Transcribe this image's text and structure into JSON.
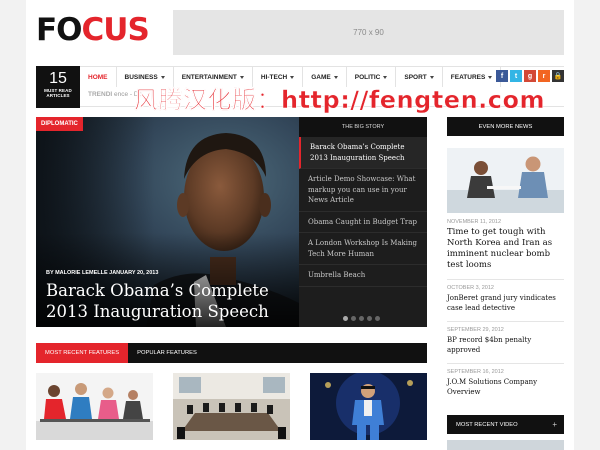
{
  "logo": {
    "part1": "FO",
    "part2": "CUS"
  },
  "ad": {
    "label": "770 x 90"
  },
  "must_read": {
    "count": "15",
    "label": "MUST READ ARTICLES"
  },
  "nav": [
    {
      "label": "Home",
      "dropdown": false,
      "active": true
    },
    {
      "label": "Business",
      "dropdown": true
    },
    {
      "label": "Entertainment",
      "dropdown": true
    },
    {
      "label": "Hi-Tech",
      "dropdown": true
    },
    {
      "label": "Game",
      "dropdown": true
    },
    {
      "label": "Politic",
      "dropdown": true
    },
    {
      "label": "Sport",
      "dropdown": true
    },
    {
      "label": "Features",
      "dropdown": true
    }
  ],
  "social": [
    {
      "icon": "facebook-icon",
      "glyph": "f",
      "color": "#3b5998"
    },
    {
      "icon": "twitter-icon",
      "glyph": "t",
      "color": "#33b5e5"
    },
    {
      "icon": "google-plus-icon",
      "glyph": "g",
      "color": "#d34836"
    },
    {
      "icon": "rss-icon",
      "glyph": "r",
      "color": "#f26522"
    },
    {
      "icon": "lock-icon",
      "glyph": "&#x1F512;",
      "color": "#333333"
    }
  ],
  "trending": {
    "label": "TRENDI",
    "text": "ence - De"
  },
  "watermark": "风腾汉化版：http://fengten.com",
  "hero": {
    "tag": "Diplomatic",
    "byline": "By Malorie Lemelle January 20, 2013",
    "title": "Barack Obama’s Complete 2013 Inauguration Speech"
  },
  "big_story": {
    "heading": "The Big Story",
    "items": [
      "Barack Obama’s Complete 2013 Inauguration Speech",
      "Article Demo Showcase: What markup you can use in your News Article",
      "Obama Caught in Budget Trap",
      "A London Workshop Is Making Tech More Human",
      "Umbrella Beach"
    ],
    "active_index": 0,
    "dots": 5,
    "active_dot": 0
  },
  "features": {
    "tabs": [
      {
        "label": "Most Recent Features",
        "active": true
      },
      {
        "label": "Popular Features",
        "active": false
      }
    ]
  },
  "sidebar": {
    "heading": "Even More News",
    "lead": {
      "date": "November 11, 2012",
      "title": "Time to get tough with North Korea and Iran as imminent nuclear bomb test looms"
    },
    "items": [
      {
        "date": "October 3, 2012",
        "title": "JonBeret grand jury vindicates case lead detective"
      },
      {
        "date": "September 29, 2012",
        "title": "BP record $4bn penalty approved"
      },
      {
        "date": "September 16, 2012",
        "title": "J.O.M Solutions Company Overview"
      }
    ],
    "video_heading": "Most Recent Video",
    "video_plus": "+"
  }
}
